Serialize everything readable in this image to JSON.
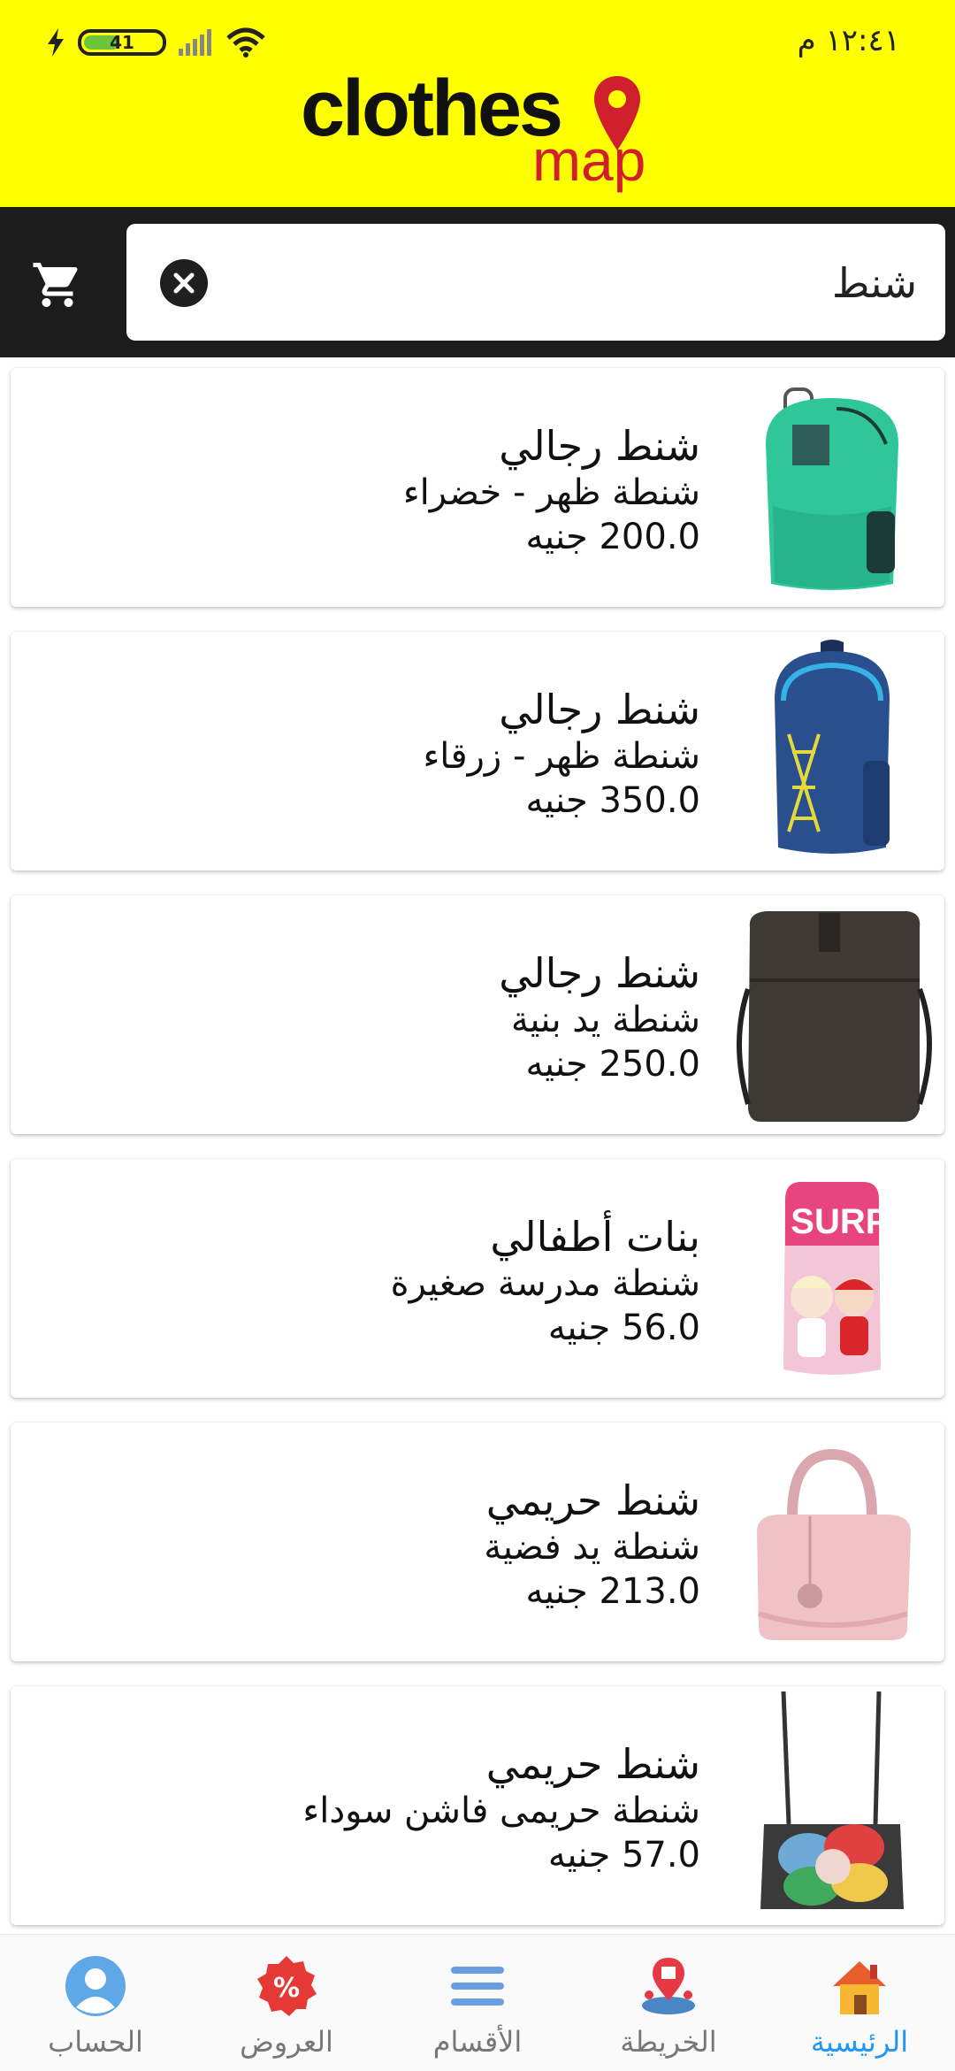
{
  "status_bar": {
    "time": "١٢:٤١ م",
    "battery_level": "41",
    "icons": [
      "charging-icon",
      "battery-icon",
      "signal-icon",
      "wifi-icon"
    ]
  },
  "header": {
    "logo_word": "clothes",
    "logo_sub": "map",
    "brand_yellow": "#ffff00",
    "brand_red": "#d0202e"
  },
  "search": {
    "value": "شنط",
    "clear_icon": "close-circle-icon",
    "cart_icon": "shopping-cart-icon"
  },
  "products": [
    {
      "category": "شنط رجالي",
      "name": "شنطة ظهر - خضراء",
      "price": "200.0 جنيه",
      "image": "green-backpack"
    },
    {
      "category": "شنط رجالي",
      "name": "شنطة ظهر - زرقاء",
      "price": "350.0 جنيه",
      "image": "blue-backpack"
    },
    {
      "category": "شنط رجالي",
      "name": "شنطة يد بنية",
      "price": "250.0 جنيه",
      "image": "brown-shoulder-bag"
    },
    {
      "category": "بنات أطفالي",
      "name": "شنطة مدرسة صغيرة",
      "price": "56.0 جنيه",
      "image": "lol-kids-backpack",
      "image_text": "L.O.L. SURPRISE!"
    },
    {
      "category": "شنط حريمي",
      "name": "شنطة يد فضية",
      "price": "213.0 جنيه",
      "image": "pink-handbag"
    },
    {
      "category": "شنط حريمي",
      "name": "شنطة حريمى فاشن سوداء",
      "price": "57.0 جنيه",
      "image": "black-flower-crossbody"
    }
  ],
  "bottom_nav": [
    {
      "label": "الرئيسية",
      "icon": "home-icon",
      "active": true
    },
    {
      "label": "الخريطة",
      "icon": "map-icon",
      "active": false
    },
    {
      "label": "الأقسام",
      "icon": "menu-icon",
      "active": false
    },
    {
      "label": "العروض",
      "icon": "percent-badge-icon",
      "active": false
    },
    {
      "label": "الحساب",
      "icon": "profile-icon",
      "active": false
    }
  ],
  "colors": {
    "active_tab": "#2196f3",
    "inactive_tab": "#777777",
    "search_bar_bg": "#1c1c1c"
  }
}
